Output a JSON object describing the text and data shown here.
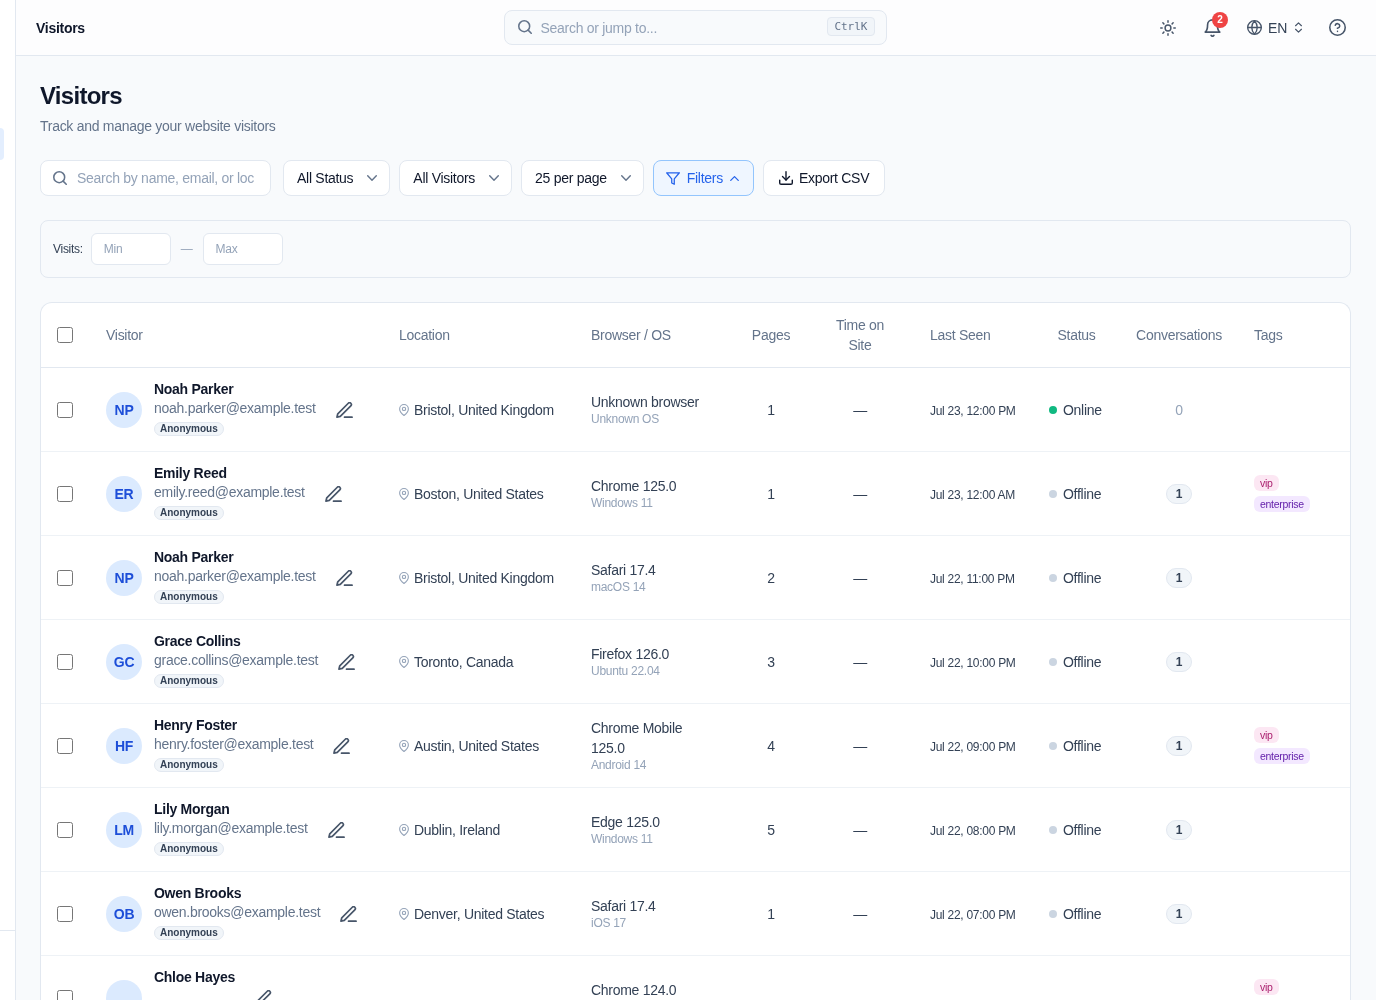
{
  "topbar": {
    "title": "Visitors",
    "search": {
      "placeholder": "Search or jump to...",
      "shortcut": "CtrlK"
    },
    "notifications": {
      "count": "2"
    },
    "language": "EN"
  },
  "page": {
    "title": "Visitors",
    "subtitle": "Track and manage your website visitors"
  },
  "toolbar": {
    "search": {
      "placeholder": "Search by name, email, or loc"
    },
    "dropdowns": [
      {
        "label": "All Status"
      },
      {
        "label": "All Visitors"
      },
      {
        "label": "25 per page"
      }
    ],
    "filters_button": {
      "label": "Filters",
      "expanded": true
    },
    "export_button": {
      "label": "Export CSV"
    }
  },
  "filter_panel": {
    "label": "Visits:",
    "min": {
      "placeholder": "Min"
    },
    "separator": "—",
    "max": {
      "placeholder": "Max"
    }
  },
  "table": {
    "select_all": {
      "checked": false
    },
    "columns": [
      "Visitor",
      "Location",
      "Browser / OS",
      "Pages",
      "Time on Site",
      "Last Seen",
      "Status",
      "Conversations",
      "Tags"
    ],
    "rows": [
      {
        "checked": false,
        "initials": "NP",
        "name": "Noah Parker",
        "email": "noah.parker@example.test",
        "badge": "Anonymous",
        "location": "Bristol, United Kingdom",
        "browser": "Unknown browser",
        "os": "Unknown OS",
        "pages": "1",
        "time_on_site": "—",
        "last_seen": "Jul 23, 12:00 PM",
        "status": {
          "label": "Online",
          "color": "#10b981"
        },
        "conversations": {
          "count": "0",
          "kind": "plain"
        },
        "tags": []
      },
      {
        "checked": false,
        "initials": "ER",
        "name": "Emily Reed",
        "email": "emily.reed@example.test",
        "badge": "Anonymous",
        "location": "Boston, United States",
        "browser": "Chrome 125.0",
        "os": "Windows 11",
        "pages": "1",
        "time_on_site": "—",
        "last_seen": "Jul 23, 12:00 AM",
        "status": {
          "label": "Offline",
          "color": "#cbd5e1"
        },
        "conversations": {
          "count": "1",
          "kind": "pill"
        },
        "tags": [
          {
            "label": "vip",
            "color": "#fce7f3"
          },
          {
            "label": "enterprise",
            "color": "#f3e8ff"
          }
        ]
      },
      {
        "checked": false,
        "initials": "NP",
        "name": "Noah Parker",
        "email": "noah.parker@example.test",
        "badge": "Anonymous",
        "location": "Bristol, United Kingdom",
        "browser": "Safari 17.4",
        "os": "macOS 14",
        "pages": "2",
        "time_on_site": "—",
        "last_seen": "Jul 22, 11:00 PM",
        "status": {
          "label": "Offline",
          "color": "#cbd5e1"
        },
        "conversations": {
          "count": "1",
          "kind": "pill"
        },
        "tags": []
      },
      {
        "checked": false,
        "initials": "GC",
        "name": "Grace Collins",
        "email": "grace.collins@example.test",
        "badge": "Anonymous",
        "location": "Toronto, Canada",
        "browser": "Firefox 126.0",
        "os": "Ubuntu 22.04",
        "pages": "3",
        "time_on_site": "—",
        "last_seen": "Jul 22, 10:00 PM",
        "status": {
          "label": "Offline",
          "color": "#cbd5e1"
        },
        "conversations": {
          "count": "1",
          "kind": "pill"
        },
        "tags": []
      },
      {
        "checked": false,
        "initials": "HF",
        "name": "Henry Foster",
        "email": "henry.foster@example.test",
        "badge": "Anonymous",
        "location": "Austin, United States",
        "browser": "Chrome Mobile 125.0",
        "os": "Android 14",
        "pages": "4",
        "time_on_site": "—",
        "last_seen": "Jul 22, 09:00 PM",
        "status": {
          "label": "Offline",
          "color": "#cbd5e1"
        },
        "conversations": {
          "count": "1",
          "kind": "pill"
        },
        "tags": [
          {
            "label": "vip",
            "color": "#fce7f3"
          },
          {
            "label": "enterprise",
            "color": "#f3e8ff"
          }
        ]
      },
      {
        "checked": false,
        "initials": "LM",
        "name": "Lily Morgan",
        "email": "lily.morgan@example.test",
        "badge": "Anonymous",
        "location": "Dublin, Ireland",
        "browser": "Edge 125.0",
        "os": "Windows 11",
        "pages": "5",
        "time_on_site": "—",
        "last_seen": "Jul 22, 08:00 PM",
        "status": {
          "label": "Offline",
          "color": "#cbd5e1"
        },
        "conversations": {
          "count": "1",
          "kind": "pill"
        },
        "tags": []
      },
      {
        "checked": false,
        "initials": "OB",
        "name": "Owen Brooks",
        "email": "owen.brooks@example.test",
        "badge": "Anonymous",
        "location": "Denver, United States",
        "browser": "Safari 17.4",
        "os": "iOS 17",
        "pages": "1",
        "time_on_site": "—",
        "last_seen": "Jul 22, 07:00 PM",
        "status": {
          "label": "Offline",
          "color": "#cbd5e1"
        },
        "conversations": {
          "count": "1",
          "kind": "pill"
        },
        "tags": []
      },
      {
        "checked": false,
        "name": "Chloe Hayes",
        "browser": "Chrome 124.0",
        "tags": [
          {
            "label": "vip",
            "color": "#fce7f3"
          }
        ]
      }
    ]
  }
}
